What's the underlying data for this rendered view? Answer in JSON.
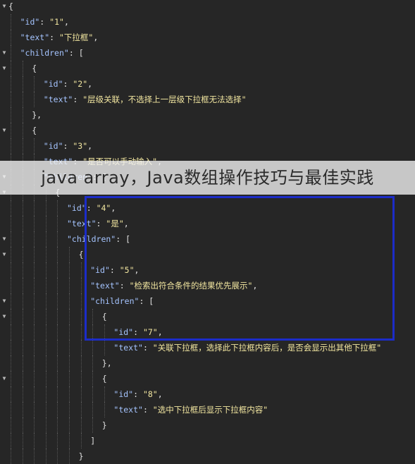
{
  "lines": [
    {
      "indent": 0,
      "fold": true,
      "parts": [
        {
          "t": "{",
          "c": "p"
        }
      ]
    },
    {
      "indent": 1,
      "fold": false,
      "parts": [
        {
          "t": "\"id\"",
          "c": "k"
        },
        {
          "t": ": ",
          "c": "p"
        },
        {
          "t": "\"1\"",
          "c": "v"
        },
        {
          "t": ",",
          "c": "p"
        }
      ]
    },
    {
      "indent": 1,
      "fold": false,
      "parts": [
        {
          "t": "\"text\"",
          "c": "k"
        },
        {
          "t": ": ",
          "c": "p"
        },
        {
          "t": "\"下拉框\"",
          "c": "v"
        },
        {
          "t": ",",
          "c": "p"
        }
      ]
    },
    {
      "indent": 1,
      "fold": true,
      "parts": [
        {
          "t": "\"children\"",
          "c": "k"
        },
        {
          "t": ": [",
          "c": "p"
        }
      ]
    },
    {
      "indent": 2,
      "fold": true,
      "parts": [
        {
          "t": "{",
          "c": "p"
        }
      ]
    },
    {
      "indent": 3,
      "fold": false,
      "parts": [
        {
          "t": "\"id\"",
          "c": "k"
        },
        {
          "t": ": ",
          "c": "p"
        },
        {
          "t": "\"2\"",
          "c": "v"
        },
        {
          "t": ",",
          "c": "p"
        }
      ]
    },
    {
      "indent": 3,
      "fold": false,
      "parts": [
        {
          "t": "\"text\"",
          "c": "k"
        },
        {
          "t": ": ",
          "c": "p"
        },
        {
          "t": "\"层级关联，不选择上一层级下拉框无法选择\"",
          "c": "v"
        }
      ]
    },
    {
      "indent": 2,
      "fold": false,
      "parts": [
        {
          "t": "},",
          "c": "p"
        }
      ]
    },
    {
      "indent": 2,
      "fold": true,
      "parts": [
        {
          "t": "{",
          "c": "p"
        }
      ]
    },
    {
      "indent": 3,
      "fold": false,
      "parts": [
        {
          "t": "\"id\"",
          "c": "k"
        },
        {
          "t": ": ",
          "c": "p"
        },
        {
          "t": "\"3\"",
          "c": "v"
        },
        {
          "t": ",",
          "c": "p"
        }
      ]
    },
    {
      "indent": 3,
      "fold": false,
      "parts": [
        {
          "t": "\"text\"",
          "c": "k"
        },
        {
          "t": ": ",
          "c": "p"
        },
        {
          "t": "\"是否可以手动输入\"",
          "c": "v"
        },
        {
          "t": ",",
          "c": "p"
        }
      ]
    },
    {
      "indent": 3,
      "fold": true,
      "parts": [
        {
          "t": "\"children\"",
          "c": "k"
        },
        {
          "t": ": [",
          "c": "p"
        }
      ]
    },
    {
      "indent": 4,
      "fold": true,
      "parts": [
        {
          "t": "{",
          "c": "p"
        }
      ]
    },
    {
      "indent": 5,
      "fold": false,
      "parts": [
        {
          "t": "\"id\"",
          "c": "k"
        },
        {
          "t": ": ",
          "c": "p"
        },
        {
          "t": "\"4\"",
          "c": "v"
        },
        {
          "t": ",",
          "c": "p"
        }
      ]
    },
    {
      "indent": 5,
      "fold": false,
      "parts": [
        {
          "t": "\"text\"",
          "c": "k"
        },
        {
          "t": ": ",
          "c": "p"
        },
        {
          "t": "\"是\"",
          "c": "v"
        },
        {
          "t": ",",
          "c": "p"
        }
      ]
    },
    {
      "indent": 5,
      "fold": true,
      "parts": [
        {
          "t": "\"children\"",
          "c": "k"
        },
        {
          "t": ": [",
          "c": "p"
        }
      ]
    },
    {
      "indent": 6,
      "fold": true,
      "parts": [
        {
          "t": "{",
          "c": "p"
        }
      ]
    },
    {
      "indent": 7,
      "fold": false,
      "parts": [
        {
          "t": "\"id\"",
          "c": "k"
        },
        {
          "t": ": ",
          "c": "p"
        },
        {
          "t": "\"5\"",
          "c": "v"
        },
        {
          "t": ",",
          "c": "p"
        }
      ]
    },
    {
      "indent": 7,
      "fold": false,
      "parts": [
        {
          "t": "\"text\"",
          "c": "k"
        },
        {
          "t": ": ",
          "c": "p"
        },
        {
          "t": "\"检索出符合条件的结果优先展示\"",
          "c": "v"
        },
        {
          "t": ",",
          "c": "p"
        }
      ]
    },
    {
      "indent": 7,
      "fold": true,
      "parts": [
        {
          "t": "\"children\"",
          "c": "k"
        },
        {
          "t": ": [",
          "c": "p"
        }
      ]
    },
    {
      "indent": 8,
      "fold": true,
      "parts": [
        {
          "t": "{",
          "c": "p"
        }
      ]
    },
    {
      "indent": 9,
      "fold": false,
      "parts": [
        {
          "t": "\"id\"",
          "c": "k"
        },
        {
          "t": ": ",
          "c": "p"
        },
        {
          "t": "\"7\"",
          "c": "v"
        },
        {
          "t": ",",
          "c": "p"
        }
      ]
    },
    {
      "indent": 9,
      "fold": false,
      "parts": [
        {
          "t": "\"text\"",
          "c": "k"
        },
        {
          "t": ": ",
          "c": "p"
        },
        {
          "t": "\"关联下拉框，选择此下拉框内容后，是否会显示出其他下拉框\"",
          "c": "v"
        }
      ]
    },
    {
      "indent": 8,
      "fold": false,
      "parts": [
        {
          "t": "},",
          "c": "p"
        }
      ]
    },
    {
      "indent": 8,
      "fold": true,
      "parts": [
        {
          "t": "{",
          "c": "p"
        }
      ]
    },
    {
      "indent": 9,
      "fold": false,
      "parts": [
        {
          "t": "\"id\"",
          "c": "k"
        },
        {
          "t": ": ",
          "c": "p"
        },
        {
          "t": "\"8\"",
          "c": "v"
        },
        {
          "t": ",",
          "c": "p"
        }
      ]
    },
    {
      "indent": 9,
      "fold": false,
      "parts": [
        {
          "t": "\"text\"",
          "c": "k"
        },
        {
          "t": ": ",
          "c": "p"
        },
        {
          "t": "\"选中下拉框后显示下拉框内容\"",
          "c": "v"
        }
      ]
    },
    {
      "indent": 8,
      "fold": false,
      "parts": [
        {
          "t": "}",
          "c": "p"
        }
      ]
    },
    {
      "indent": 7,
      "fold": false,
      "parts": [
        {
          "t": "]",
          "c": "p"
        }
      ]
    },
    {
      "indent": 6,
      "fold": false,
      "parts": [
        {
          "t": "}",
          "c": "p"
        }
      ]
    }
  ],
  "banner": {
    "text": "java array，Java数组操作技巧与最佳实践"
  },
  "colors": {
    "background": "#262626",
    "key": "#a5c4ff",
    "string": "#f2e6a0",
    "highlight": "#1c2cc8"
  },
  "icons": {
    "fold": "triangle-down-icon"
  }
}
